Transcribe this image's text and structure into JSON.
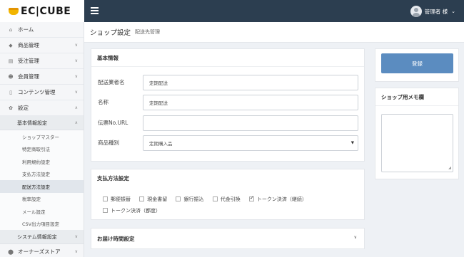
{
  "header": {
    "logo_text": "EC|CUBE",
    "user_name": "管理者 様"
  },
  "sidebar": {
    "items": [
      {
        "icon": "home-icon",
        "label": "ホーム"
      },
      {
        "icon": "tag-icon",
        "label": "商品管理"
      },
      {
        "icon": "cart-icon",
        "label": "受注管理"
      },
      {
        "icon": "users-icon",
        "label": "会員管理"
      },
      {
        "icon": "file-icon",
        "label": "コンテンツ管理"
      },
      {
        "icon": "gear-icon",
        "label": "設定"
      }
    ],
    "subgroup": {
      "label": "基本情報設定",
      "items": [
        "ショップマスター",
        "特定商取引法",
        "利用規約設定",
        "支払方法設定",
        "配送方法設定",
        "税率設定",
        "メール設定",
        "CSV出力項目設定"
      ],
      "active_index": 4
    },
    "system_label": "システム情報設定",
    "owners_label": "オーナーズストア"
  },
  "page": {
    "title": "ショップ設定",
    "subtitle": "配送先管理"
  },
  "basic_info": {
    "title": "基本情報",
    "fields": {
      "delivery_name_label": "配送業者名",
      "delivery_name_value": "定期配送",
      "name_label": "名称",
      "name_value": "定期配送",
      "tracking_url_label": "伝票No.URL",
      "tracking_url_value": "",
      "product_type_label": "商品種別",
      "product_type_value": "定期購入品"
    }
  },
  "payment": {
    "title": "支払方法設定",
    "options": [
      {
        "label": "郵便振替",
        "checked": false
      },
      {
        "label": "現金書留",
        "checked": false
      },
      {
        "label": "銀行振込",
        "checked": false
      },
      {
        "label": "代金引換",
        "checked": false
      },
      {
        "label": "トークン決済（継続）",
        "checked": true
      },
      {
        "label": "トークン決済（都度）",
        "checked": false
      }
    ]
  },
  "delivery_time": {
    "title": "お届け時間設定"
  },
  "right": {
    "register_label": "登録",
    "memo_title": "ショップ用メモ欄",
    "memo_value": ""
  },
  "colors": {
    "header_bg": "#2c3e50",
    "primary_button": "#5b8cc0",
    "logo_yellow": "#f2b500"
  }
}
